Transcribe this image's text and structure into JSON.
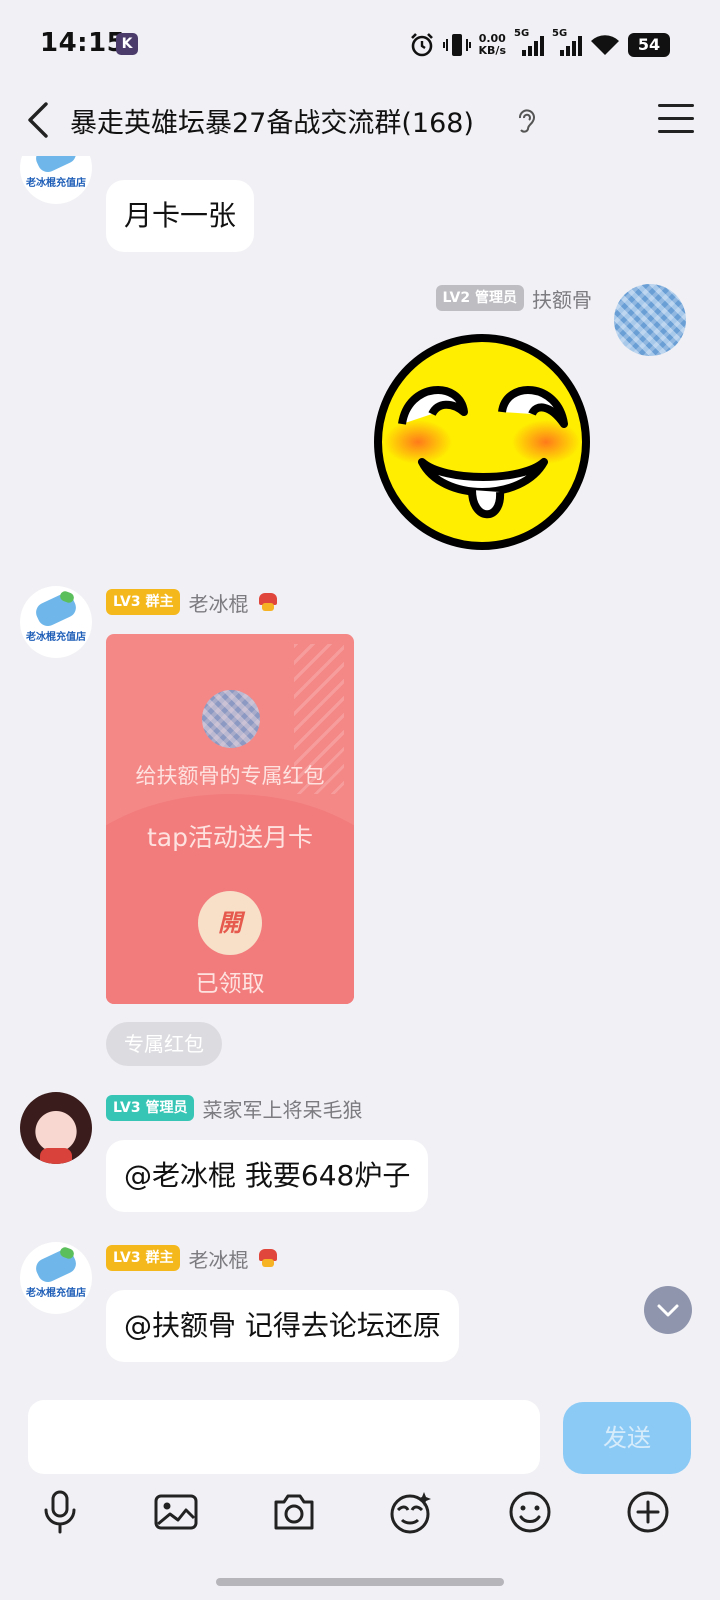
{
  "status_bar": {
    "time": "14:15",
    "app_icon": "K",
    "net_speed": "0.00",
    "net_unit": "KB/s",
    "sim1": "5G",
    "sim2": "5G",
    "battery": "54",
    "icons": [
      "alarm-icon",
      "vibrate-icon",
      "signal-icon",
      "wifi-icon",
      "battery-icon"
    ]
  },
  "header": {
    "title": "暴走英雄坛暴27备战交流群(168)",
    "back_icon": "chevron-left-icon",
    "ear_icon": "ear-icon",
    "menu_icon": "menu-icon"
  },
  "messages": [
    {
      "type": "text",
      "side": "left",
      "avatar_text": "老冰棍充值店",
      "text": "月卡一张"
    },
    {
      "type": "sticker",
      "side": "right",
      "badge": "LV2 管理员",
      "nickname": "扶额骨",
      "sticker": "drooling-smiley-sticker"
    },
    {
      "type": "red_packet",
      "side": "left",
      "badge": "LV3 群主",
      "nickname": "老冰棍",
      "avatar_text": "老冰棍充值店",
      "packet_title": "给扶额骨的专属红包",
      "packet_message": "tap活动送月卡",
      "open_label": "開",
      "status": "已领取",
      "tag": "专属红包"
    },
    {
      "type": "text",
      "side": "left",
      "badge": "LV3 管理员",
      "nickname": "菜家军上将呆毛狼",
      "text": "@老冰棍 我要648炉子"
    },
    {
      "type": "text",
      "side": "left",
      "badge": "LV3 群主",
      "nickname": "老冰棍",
      "avatar_text": "老冰棍充值店",
      "text": "@扶额骨 记得去论坛还原"
    }
  ],
  "composer": {
    "input_value": "",
    "send_label": "发送",
    "tools": [
      "microphone-icon",
      "image-icon",
      "camera-icon",
      "sticker-icon",
      "emoji-icon",
      "plus-icon"
    ]
  },
  "colors": {
    "background": "#f1f1f5",
    "send_button": "#8ccaf6",
    "red_packet": "#f48887",
    "badge_owner": "#f5b81c",
    "badge_admin_teal": "#37c6b6",
    "badge_admin_gray": "#bdbdc2"
  }
}
